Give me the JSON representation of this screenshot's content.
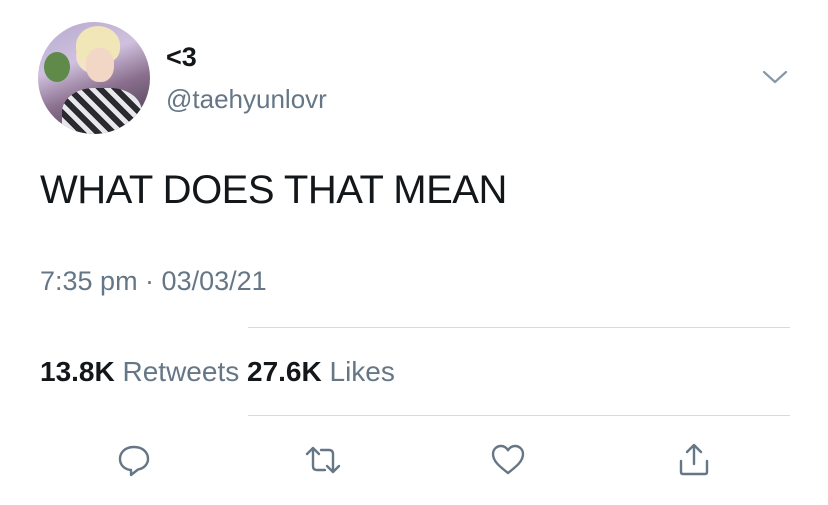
{
  "user": {
    "display_name": "<3",
    "handle": "@taehyunlovr"
  },
  "tweet": {
    "text": "WHAT DOES THAT MEAN",
    "timestamp": "7:35 pm · 03/03/21"
  },
  "stats": {
    "retweets_count": "13.8K",
    "retweets_label": "Retweets",
    "likes_count": "27.6K",
    "likes_label": "Likes"
  },
  "actions": {
    "reply_icon": "reply-icon",
    "retweet_icon": "retweet-icon",
    "like_icon": "heart-icon",
    "share_icon": "share-icon"
  },
  "colors": {
    "text": "#14171a",
    "secondary": "#657786",
    "icon": "#657786",
    "divider": "#d5dbe0"
  }
}
